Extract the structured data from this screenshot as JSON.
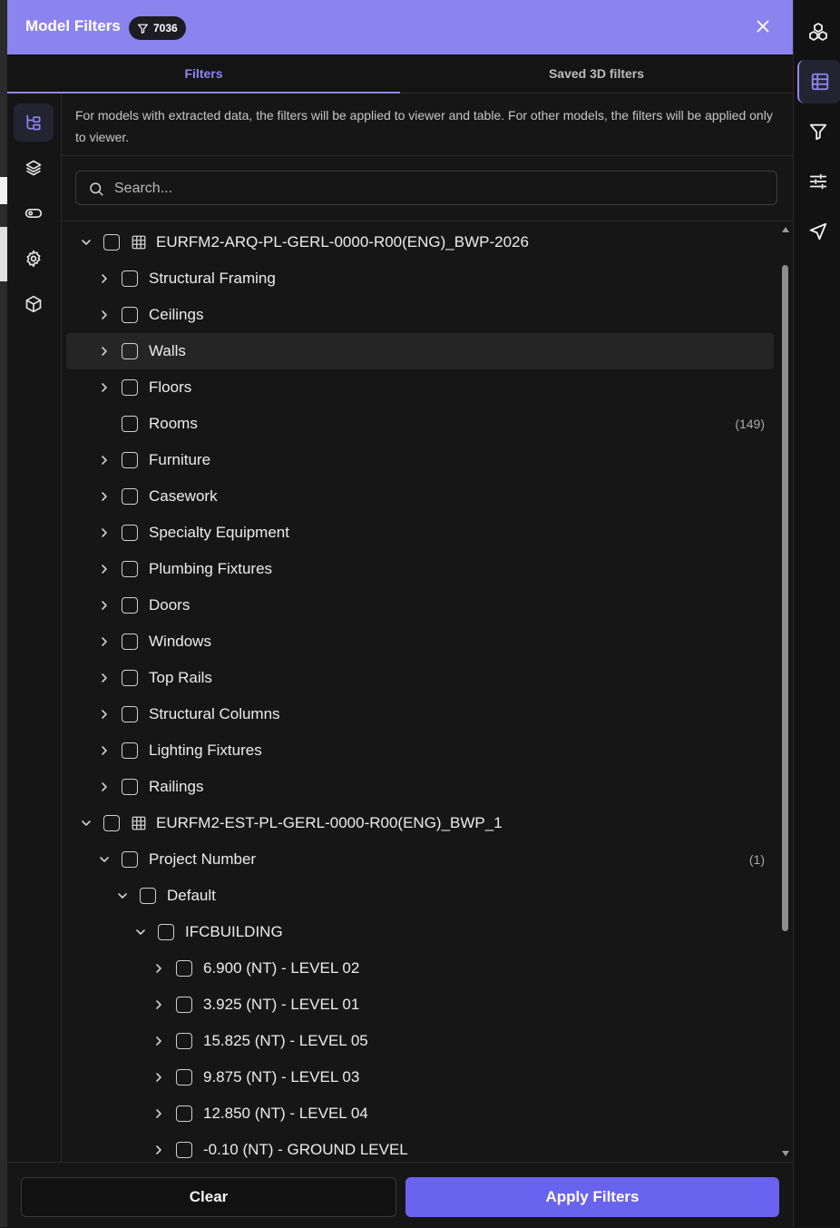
{
  "header": {
    "title": "Model Filters",
    "badge_count": "7036"
  },
  "tabs": [
    {
      "label": "Filters",
      "active": true
    },
    {
      "label": "Saved 3D filters",
      "active": false
    }
  ],
  "info_text": "For models with extracted data, the filters will be applied to viewer and table. For other models, the filters will be applied only to viewer.",
  "search": {
    "placeholder": "Search...",
    "value": ""
  },
  "tree": [
    {
      "label": "EURFM2-ARQ-PL-GERL-0000-R00(ENG)_BWP-2026",
      "expanded": true,
      "icon": "table-grid-icon"
    },
    {
      "label": "Structural Framing"
    },
    {
      "label": "Ceilings"
    },
    {
      "label": "Walls",
      "hover": true
    },
    {
      "label": "Floors"
    },
    {
      "label": "Rooms",
      "count": "(149)"
    },
    {
      "label": "Furniture"
    },
    {
      "label": "Casework"
    },
    {
      "label": "Specialty Equipment"
    },
    {
      "label": "Plumbing Fixtures"
    },
    {
      "label": "Doors"
    },
    {
      "label": "Windows"
    },
    {
      "label": "Top Rails"
    },
    {
      "label": "Structural Columns"
    },
    {
      "label": "Lighting Fixtures"
    },
    {
      "label": "Railings"
    },
    {
      "label": "EURFM2-EST-PL-GERL-0000-R00(ENG)_BWP_1",
      "expanded": true,
      "icon": "table-grid-icon"
    },
    {
      "label": "Project Number",
      "expanded": true,
      "count": "(1)"
    },
    {
      "label": "Default",
      "expanded": true
    },
    {
      "label": "IFCBUILDING",
      "expanded": true
    },
    {
      "label": "6.900 (NT) - LEVEL 02"
    },
    {
      "label": "3.925 (NT) - LEVEL 01"
    },
    {
      "label": "15.825 (NT) - LEVEL 05"
    },
    {
      "label": "9.875 (NT) - LEVEL 03"
    },
    {
      "label": "12.850 (NT) - LEVEL 04"
    },
    {
      "label": "-0.10 (NT) - GROUND LEVEL"
    }
  ],
  "footer": {
    "clear_label": "Clear",
    "apply_label": "Apply Filters"
  },
  "left_rail_icons": [
    "model-tree-icon",
    "layers-icon",
    "toggle-icon",
    "settings-gear-icon",
    "cube-icon"
  ],
  "right_toolbar_icons": [
    "cubes-cluster-icon",
    "table-icon",
    "filter-icon",
    "sliders-icon",
    "navigation-arrow-icon"
  ],
  "colors": {
    "accent": "#8d87f3",
    "header_bg": "#8b84ee",
    "apply_bg": "#6a63f0",
    "panel_bg": "#161616"
  }
}
